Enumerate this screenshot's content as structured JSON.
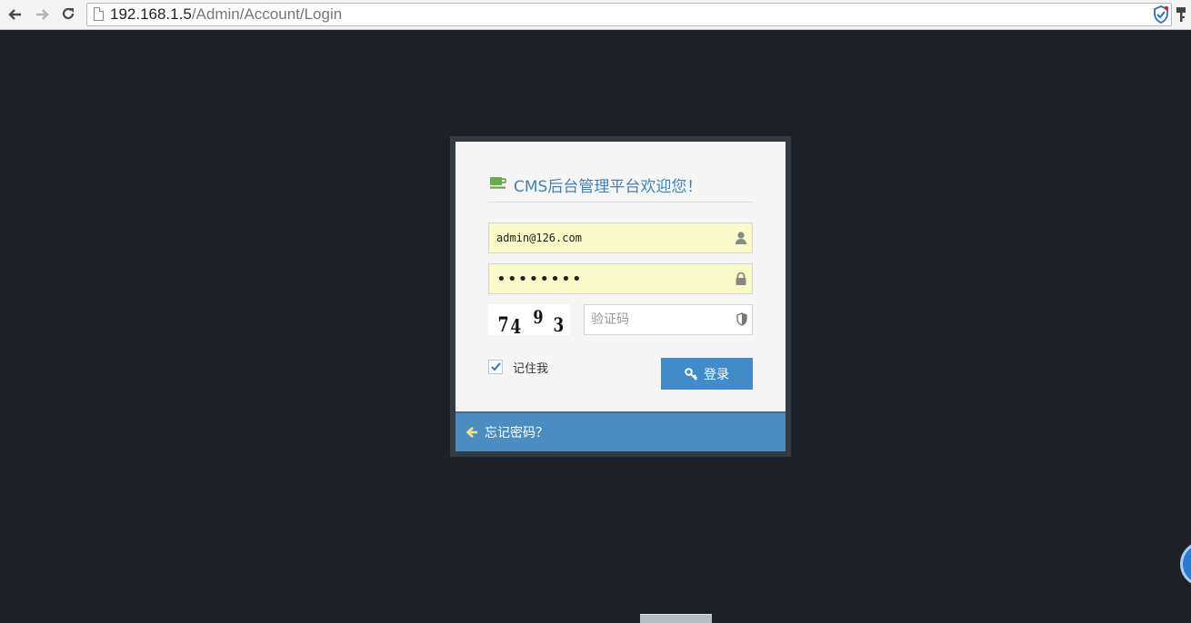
{
  "browser": {
    "url_host": "192.168.1.5",
    "url_path": "/Admin/Account/Login",
    "back_label": "←",
    "forward_label": "→",
    "reload_label": "⟳"
  },
  "login": {
    "title": "CMS后台管理平台欢迎您！",
    "email_value": "admin@126.com",
    "password_value": "••••••••",
    "captcha_digits": [
      "7",
      "4",
      "9",
      "3"
    ],
    "captcha_placeholder": "验证码",
    "remember_label": "记住我",
    "remember_checked": true,
    "submit_label": "登录",
    "forgot_label": "忘记密码？"
  },
  "colors": {
    "page_bg": "#1d2024",
    "accent": "#428bca",
    "title": "#4383b4",
    "autofill": "#fafac8"
  }
}
